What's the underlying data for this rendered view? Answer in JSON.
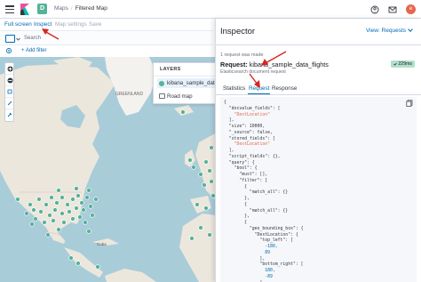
{
  "header": {
    "space_initial": "D",
    "breadcrumbs": [
      "Maps",
      "Filtered Map"
    ],
    "avatar_initial": "e"
  },
  "toolbar": {
    "full_screen": "Full screen",
    "inspect": "Inspect",
    "map_settings": "Map settings",
    "save": "Save"
  },
  "query": {
    "search_label": "Search",
    "add_filter": "+ Add filter"
  },
  "map": {
    "labels": [
      "GREENLAND",
      "Cuba"
    ],
    "layers_title": "LAYERS",
    "layers": [
      "kibana_sample_data_...",
      "Road map"
    ]
  },
  "inspector": {
    "title": "Inspector",
    "view": "View: Requests",
    "requests_made": "1 request was made",
    "request_label": "Request:",
    "request_name": "kibana_sample_data_flights",
    "time_badge": "229ms",
    "es_doc": "Elasticsearch document request",
    "tabs": [
      "Statistics",
      "Request",
      "Response"
    ],
    "active_tab": "Request",
    "code_lines": [
      "{",
      "  \"docvalue_fields\": [",
      "    \"DestLocation\"",
      "  ],",
      "  \"size\": 10000,",
      "  \"_source\": false,",
      "  \"stored_fields\": [",
      "    \"DestLocation\"",
      "  ],",
      "  \"script_fields\": {},",
      "  \"query\": {",
      "    \"bool\": {",
      "      \"must\": [],",
      "      \"filter\": [",
      "        {",
      "          \"match_all\": {}",
      "        },",
      "        {",
      "          \"match_all\": {}",
      "        },",
      "        {",
      "          \"geo_bounding_box\": {",
      "            \"DestLocation\": {",
      "              \"top_left\": [",
      "                -180,",
      "                89",
      "              ],",
      "              \"bottom_right\": [",
      "                180,",
      "                -89",
      "              ]"
    ]
  },
  "colors": {
    "accent": "#006bb4",
    "marker": "#54b399",
    "annotation_arrow": "#d6261f",
    "badge": "#b2e0cb"
  }
}
